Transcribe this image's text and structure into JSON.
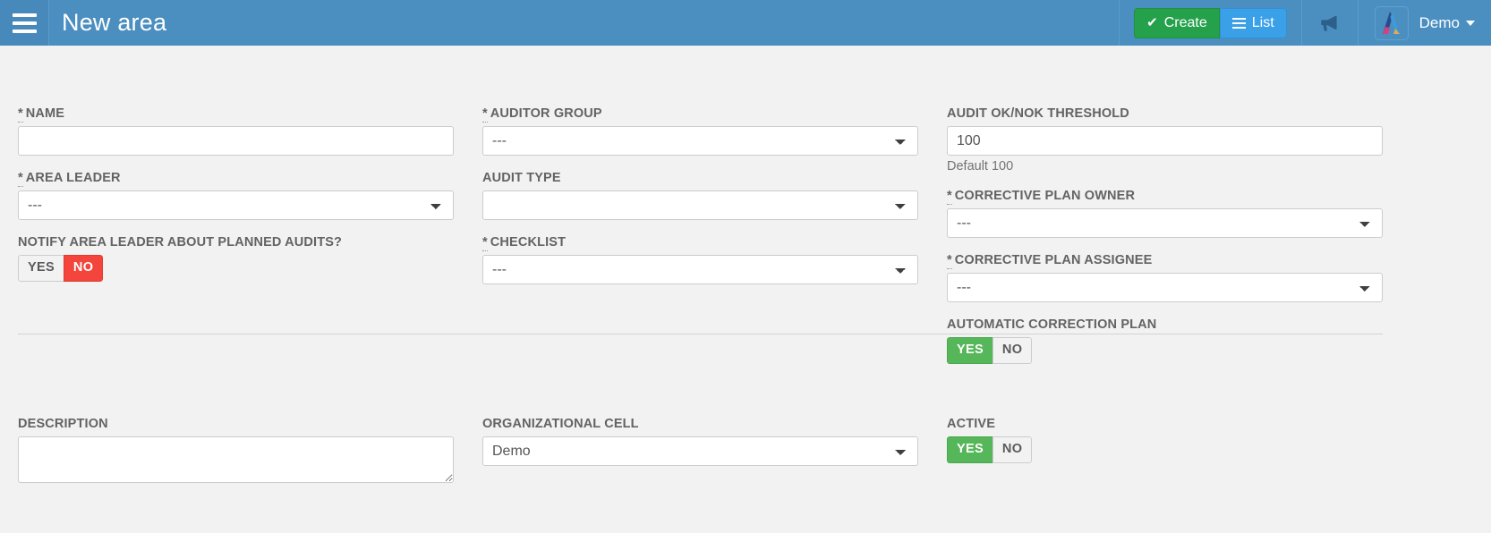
{
  "header": {
    "menu_icon": "hamburger-icon",
    "title": "New area",
    "create_label": "Create",
    "create_icon": "check-icon",
    "list_label": "List",
    "list_icon": "list-icon",
    "announcement_icon": "megaphone-icon",
    "logo_icon": "app-logo-icon",
    "user_label": "Demo",
    "user_caret_icon": "chevron-down-icon",
    "colors": {
      "navbar_bg": "#4b8ec0",
      "menu_panel_bg": "#4789bb",
      "create_bg": "#25a14c",
      "list_bg": "#3aa0e8"
    }
  },
  "form": {
    "columns": {
      "col1": [
        {
          "id": "name",
          "label": "NAME",
          "required": true,
          "type": "text",
          "value": "",
          "placeholder": ""
        },
        {
          "id": "area-leader",
          "label": "AREA LEADER",
          "required": true,
          "type": "select",
          "value": "---"
        },
        {
          "id": "notify-area-leader",
          "label": "NOTIFY AREA LEADER ABOUT PLANNED AUDITS?",
          "required": false,
          "type": "toggle",
          "yes_label": "YES",
          "no_label": "NO",
          "selected": "NO"
        }
      ],
      "col2": [
        {
          "id": "auditor-group",
          "label": "AUDITOR GROUP",
          "required": true,
          "type": "select",
          "value": "---"
        },
        {
          "id": "audit-type",
          "label": "AUDIT TYPE",
          "required": false,
          "type": "select",
          "value": ""
        },
        {
          "id": "checklist",
          "label": "CHECKLIST",
          "required": true,
          "type": "select",
          "value": "---"
        }
      ],
      "col3": [
        {
          "id": "audit-ok-nok-threshold",
          "label": "AUDIT OK/NOK THRESHOLD",
          "required": false,
          "type": "text",
          "value": "100",
          "help": "Default 100"
        },
        {
          "id": "corrective-plan-owner",
          "label": "CORRECTIVE PLAN OWNER",
          "required": true,
          "type": "select",
          "value": "---"
        },
        {
          "id": "corrective-plan-assignee",
          "label": "CORRECTIVE PLAN ASSIGNEE",
          "required": true,
          "type": "select",
          "value": "---"
        },
        {
          "id": "automatic-correction-plan",
          "label": "AUTOMATIC CORRECTION PLAN",
          "required": false,
          "type": "toggle",
          "yes_label": "YES",
          "no_label": "NO",
          "selected": "YES"
        }
      ]
    },
    "section2": {
      "description": {
        "label": "DESCRIPTION",
        "value": "",
        "placeholder": ""
      },
      "organizational_cell": {
        "label": "ORGANIZATIONAL CELL",
        "value": "Demo"
      },
      "active": {
        "label": "ACTIVE",
        "yes_label": "YES",
        "no_label": "NO",
        "selected": "YES"
      }
    },
    "required_marker": "*"
  }
}
